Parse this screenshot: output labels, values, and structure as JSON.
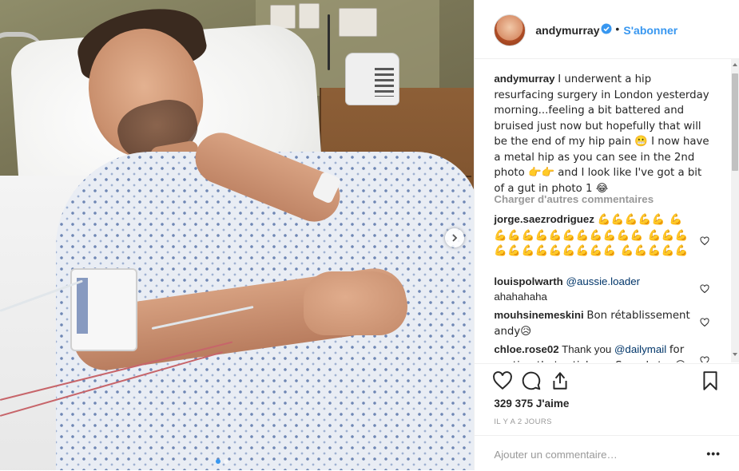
{
  "post": {
    "username": "andymurray",
    "verified": true,
    "separator": "•",
    "follow_label": "S'abonner",
    "caption_user": "andymurray",
    "caption_text": "I underwent a hip resurfacing surgery in London yesterday morning...feeling a bit battered and bruised just now but hopefully that will be the end of my hip pain 😬 I now have a metal hip as you can see in the 2nd photo 👉👉 and I look like I've got a bit of a gut in photo 1 😂"
  },
  "comments": {
    "load_more_label": "Charger d'autres commentaires",
    "items": [
      {
        "user": "jorge.saezrodriguez",
        "text": "💪💪💪💪💪 💪💪💪💪💪💪💪💪💪💪💪💪 💪💪💪💪💪💪💪💪💪💪💪💪 💪💪💪💪💪"
      },
      {
        "user": "louispolwarth",
        "mention": "@aussie.loader",
        "text": "ahahahaha"
      },
      {
        "user": "mouhsinemeskini",
        "text": "Bon rétablissement andy😥"
      },
      {
        "user": "chloe.rose02",
        "text_pre": "Thank you",
        "mention": "@dailymail",
        "text": "for posting that article .... Sounds to..😁😁"
      }
    ]
  },
  "stats": {
    "likes": "329 375 J'aime",
    "time": "IL Y A 2 JOURS"
  },
  "add_comment": {
    "placeholder": "Ajouter un commentaire…",
    "more_label": "•••"
  },
  "icons": {
    "like": "heart-icon",
    "comment": "comment-icon",
    "share": "share-icon",
    "save": "bookmark-icon",
    "next": "chevron-right-icon",
    "verified": "verified-badge-icon"
  },
  "colors": {
    "link_blue": "#3897f0",
    "text": "#262626",
    "muted": "#999999",
    "border": "#efefef"
  }
}
